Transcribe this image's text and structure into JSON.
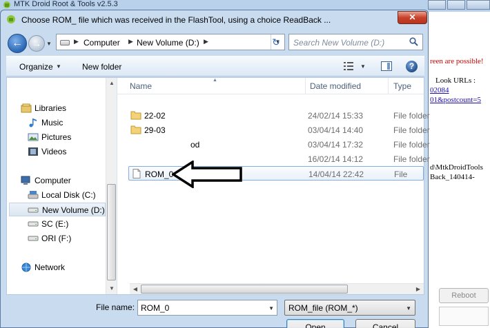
{
  "background_window": {
    "title": "MTK Droid Root & Tools v2.5.3",
    "lines": [
      {
        "text": "reen are possible!",
        "style": "red"
      },
      {
        "text": "Look URLs :",
        "style": "plain"
      },
      {
        "text": "02084",
        "style": "link"
      },
      {
        "text": "01&postcount=5",
        "style": "link"
      },
      {
        "text": "d\\MtkDroidTools",
        "style": "plain"
      },
      {
        "text": "Back_140414-",
        "style": "plain"
      }
    ],
    "reboot_label": "Reboot"
  },
  "dialog": {
    "title": "Choose ROM_ file which was received in the FlashTool, using a choice ReadBack ...",
    "close_label": "✕"
  },
  "breadcrumb": {
    "items": [
      "Computer",
      "New Volume (D:)"
    ]
  },
  "search": {
    "placeholder": "Search New Volume (D:)"
  },
  "toolbar": {
    "organize_label": "Organize",
    "new_folder_label": "New folder"
  },
  "nav_pane": {
    "items": [
      {
        "label": "Libraries",
        "icon": "libraries-icon"
      },
      {
        "label": "Music",
        "icon": "music-icon"
      },
      {
        "label": "Pictures",
        "icon": "pictures-icon"
      },
      {
        "label": "Videos",
        "icon": "videos-icon"
      },
      {
        "label": "Computer",
        "icon": "computer-icon"
      },
      {
        "label": "Local Disk (C:)",
        "icon": "local-disk-icon"
      },
      {
        "label": "New Volume (D:)",
        "icon": "drive-icon",
        "selected": true
      },
      {
        "label": "SC (E:)",
        "icon": "drive-icon"
      },
      {
        "label": "ORI (F:)",
        "icon": "drive-icon"
      },
      {
        "label": "Network",
        "icon": "network-icon"
      }
    ]
  },
  "file_list": {
    "columns": [
      "Name",
      "Date modified",
      "Type"
    ],
    "rows": [
      {
        "name": "22-02",
        "date": "24/02/14 15:33",
        "type": "File folder",
        "icon": "folder-icon"
      },
      {
        "name": "29-03",
        "date": "03/04/14 14:40",
        "type": "File folder",
        "icon": "folder-icon"
      },
      {
        "name": "od",
        "date": "03/04/14 17:32",
        "type": "File folder",
        "icon": "folder-icon"
      },
      {
        "name": "",
        "date": "16/02/14 14:12",
        "type": "File folder",
        "icon": "folder-icon"
      },
      {
        "name": "ROM_0",
        "date": "14/04/14 22:42",
        "type": "File",
        "icon": "file-icon",
        "selected": true
      }
    ]
  },
  "footer": {
    "file_name_label": "File name:",
    "file_name_value": "ROM_0",
    "file_type_value": "ROM_file (ROM_*)",
    "open_label": "Open",
    "cancel_label": "Cancel"
  },
  "colors": {
    "selection_border": "#84acdd",
    "title_close_red": "#c9422b",
    "annotation_arrow": "#000000"
  }
}
